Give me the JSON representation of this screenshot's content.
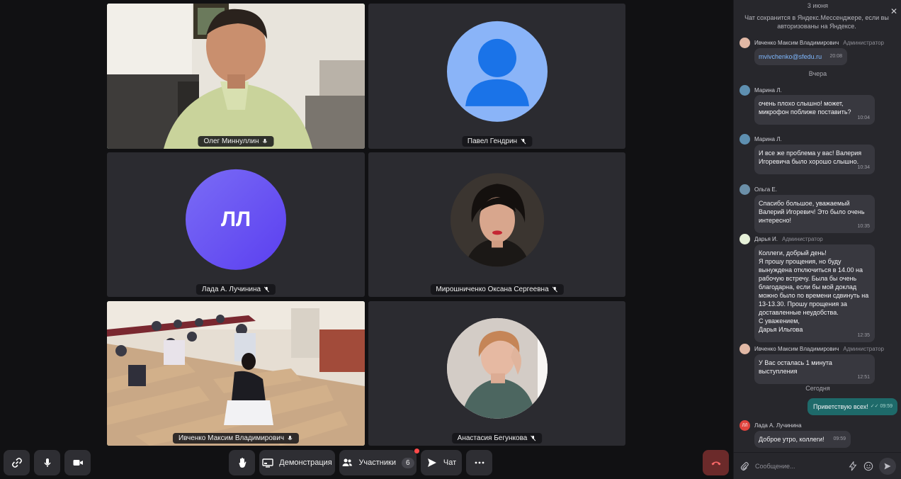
{
  "tiles": {
    "t1": {
      "name": "Олег Миннуллин"
    },
    "t2": {
      "name": "Павел Гендрин"
    },
    "t3": {
      "name": "Лада А. Лучинина",
      "initials": "ЛЛ"
    },
    "t4": {
      "name": "Мирошниченко Оксана Сергеевна"
    },
    "t5": {
      "name": "Ивченко Максим Владимирович"
    },
    "t6": {
      "name": "Анастасия Бегункова"
    }
  },
  "toolbar": {
    "demo_label": "Демонстрация",
    "participants_label": "Участники",
    "participants_count": "6",
    "chat_label": "Чат"
  },
  "chat": {
    "date_top": "3 июня",
    "notice": "Чат сохранится в Яндекс.Мессенджере, если вы авторизованы на Яндексе.",
    "date_yesterday": "Вчера",
    "date_today": "Сегодня",
    "input_placeholder": "Сообщение...",
    "messages": [
      {
        "author": "Ивченко Максим Владимирович",
        "role": "Администратор",
        "text": "mvivchenko@sfedu.ru",
        "time": "20:08"
      },
      {
        "author": "Марина Л.",
        "role": "",
        "text": "очень плохо слышно! может, микрофон поближе поставить?",
        "time": "10:04"
      },
      {
        "author": "Марина Л.",
        "role": "",
        "text": "И все же проблема у вас! Валерия Игоревича было хорошо слышно.",
        "time": "10:34"
      },
      {
        "author": "Ольга Е.",
        "role": "",
        "text": "Спасибо большое, уважаемый Валерий Игоревич! Это было очень интересно!",
        "time": "10:35"
      },
      {
        "author": "Дарья И.",
        "role": "Администратор",
        "lines": [
          "Коллеги, добрый день!",
          "Я прошу прощения, но буду вынуждена отключиться в 14.00 на рабочую встречу. Была бы очень благодарна, если бы мой доклад можно было по времени сдвинуть на 13-13.30. Прошу прощения за доставленные неудобства.",
          "С уважением,",
          "Дарья Ильгова"
        ],
        "time": "12:35"
      },
      {
        "author": "Ивченко Максим Владимирович",
        "role": "Администратор",
        "text": "У Вас осталась 1 минута выступления",
        "time": "12:51"
      },
      {
        "author": "",
        "role": "",
        "text": "Приветствую всех!",
        "time": "09:59"
      },
      {
        "author": "Лада А. Лучинина",
        "role": "",
        "avatar_initials": "ЛЛ",
        "text": "Доброе утро, коллеги!",
        "time": "09:59"
      }
    ]
  },
  "colors": {
    "speaking": "#4ed87a",
    "accent_avatar": "#6a5af0",
    "placeholder_avatar": "#8ab4f8"
  }
}
